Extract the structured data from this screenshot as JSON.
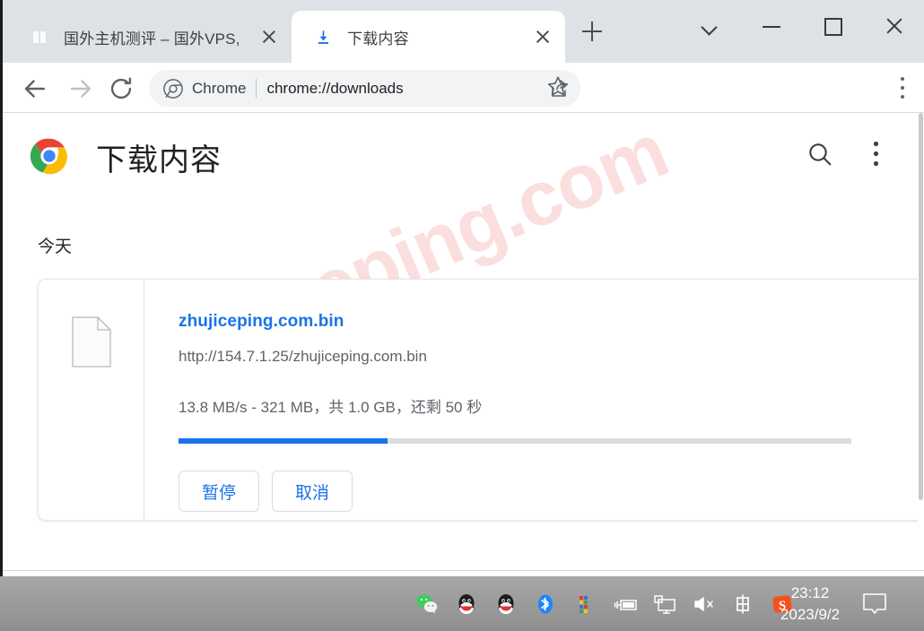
{
  "window": {
    "controls": [
      {
        "name": "tab-search-chevron",
        "icon": "chevron-down-icon"
      },
      {
        "name": "minimize",
        "icon": "minimize-icon"
      },
      {
        "name": "maximize",
        "icon": "maximize-icon"
      },
      {
        "name": "close",
        "icon": "close-icon"
      }
    ]
  },
  "tabs": [
    {
      "title": "国外主机测评 – 国外VPS,",
      "favicon": "site-favicon",
      "active": false
    },
    {
      "title": "下载内容",
      "favicon": "download-icon",
      "active": true
    }
  ],
  "newtab_tooltip": "+",
  "toolbar": {
    "back_icon": "back-arrow-icon",
    "forward_icon": "forward-arrow-icon",
    "reload_icon": "reload-icon",
    "omnibox": {
      "chrome_label": "Chrome",
      "url": "chrome://downloads",
      "share_icon": "share-icon",
      "star_icon": "star-icon"
    },
    "menu_icon": "three-dot-menu-icon"
  },
  "page": {
    "title": "下载内容",
    "search_icon": "search-icon",
    "menu_icon": "three-dot-menu-icon",
    "watermark": "zhujiceping.com",
    "date_group": "今天",
    "download": {
      "file_icon": "file-icon",
      "filename": "zhujiceping.com.bin",
      "url": "http://154.7.1.25/zhujiceping.com.bin",
      "status": "13.8 MB/s - 321 MB，共 1.0 GB，还剩 50 秒",
      "progress_percent": 31,
      "buttons": [
        {
          "label": "暂停",
          "name": "pause-button"
        },
        {
          "label": "取消",
          "name": "cancel-button"
        }
      ]
    }
  },
  "taskbar": {
    "tray_icons": [
      "wechat-icon",
      "qq-icon",
      "qq-icon-2",
      "bluetooth-icon",
      "color-grid-icon",
      "battery-icon",
      "display-icon",
      "volume-muted-icon",
      "ime-chinese-icon",
      "sogou-icon"
    ],
    "clock": {
      "time": "23:12",
      "date": "2023/9/2"
    },
    "notification_icon": "notification-icon"
  },
  "colors": {
    "accent": "#1a73e8",
    "tabstrip": "#dee1e6",
    "omnibox_bg": "#f1f3f4",
    "watermark": "#fbdede",
    "taskbar": "#9b9b9b"
  }
}
